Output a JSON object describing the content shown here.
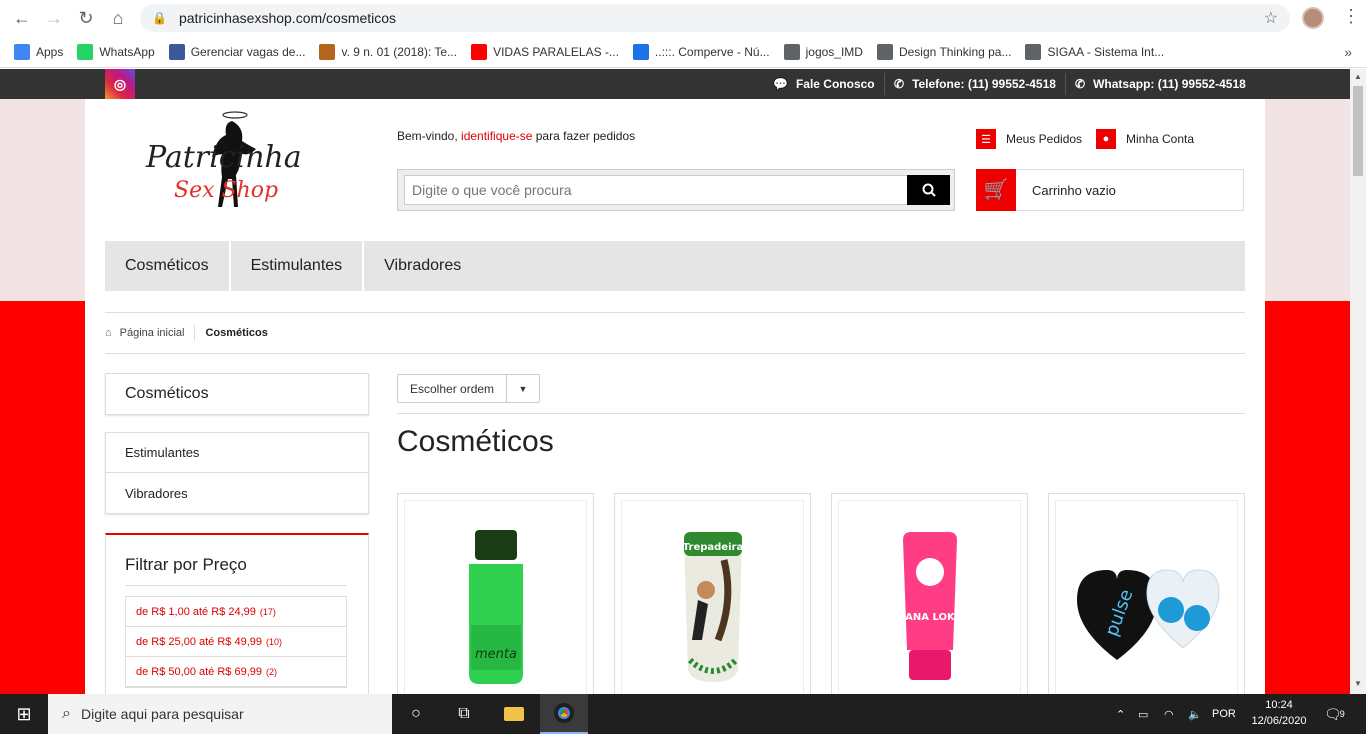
{
  "browser": {
    "url": "patricinhasexshop.com/cosmeticos",
    "bookmarks": [
      {
        "label": "Apps",
        "color": "#4285f4"
      },
      {
        "label": "WhatsApp",
        "color": "#25d366"
      },
      {
        "label": "Gerenciar vagas de...",
        "color": "#3b5998"
      },
      {
        "label": "v. 9 n. 01 (2018): Te...",
        "color": "#b5651d"
      },
      {
        "label": "VIDAS PARALELAS -...",
        "color": "#ff0000"
      },
      {
        "label": "..:::. Comperve - Nú...",
        "color": "#1a73e8"
      },
      {
        "label": "jogos_IMD",
        "color": "#5f6368"
      },
      {
        "label": "Design Thinking pa...",
        "color": "#5f6368"
      },
      {
        "label": "SIGAA - Sistema Int...",
        "color": "#5f6368"
      }
    ]
  },
  "topbar": {
    "contact": "Fale Conosco",
    "phone": "Telefone: (11) 99552-4518",
    "whatsapp": "Whatsapp: (11) 99552-4518"
  },
  "header": {
    "logo_line1": "Patricinha",
    "logo_line2": "Sex Shop",
    "welcome_prefix": "Bem-vindo, ",
    "welcome_link": "identifique-se",
    "welcome_suffix": " para fazer pedidos",
    "search_placeholder": "Digite o que você procura",
    "orders": "Meus Pedidos",
    "account": "Minha Conta",
    "cart": "Carrinho vazio"
  },
  "menu": [
    "Cosméticos",
    "Estimulantes",
    "Vibradores"
  ],
  "breadcrumb": {
    "home": "Página inicial",
    "current": "Cosméticos"
  },
  "sidebar": {
    "current": "Cosméticos",
    "categories": [
      "Estimulantes",
      "Vibradores"
    ],
    "filter_title": "Filtrar por Preço",
    "price_filters": [
      {
        "label": "de R$ 1,00 até R$ 24,99",
        "count": "(17)"
      },
      {
        "label": "de R$ 25,00 até R$ 49,99",
        "count": "(10)"
      },
      {
        "label": "de R$ 50,00 até R$ 69,99",
        "count": "(2)"
      }
    ]
  },
  "listing": {
    "sort_label": "Escolher ordem",
    "title": "Cosméticos",
    "product_labels": {
      "p1": "menta",
      "p2": "Trepadeira",
      "p3": "XANA LOKA",
      "p4": "pulse"
    }
  },
  "taskbar": {
    "search": "Digite aqui para pesquisar",
    "lang": "POR",
    "time": "10:24",
    "date": "12/06/2020",
    "notifications": "9"
  }
}
